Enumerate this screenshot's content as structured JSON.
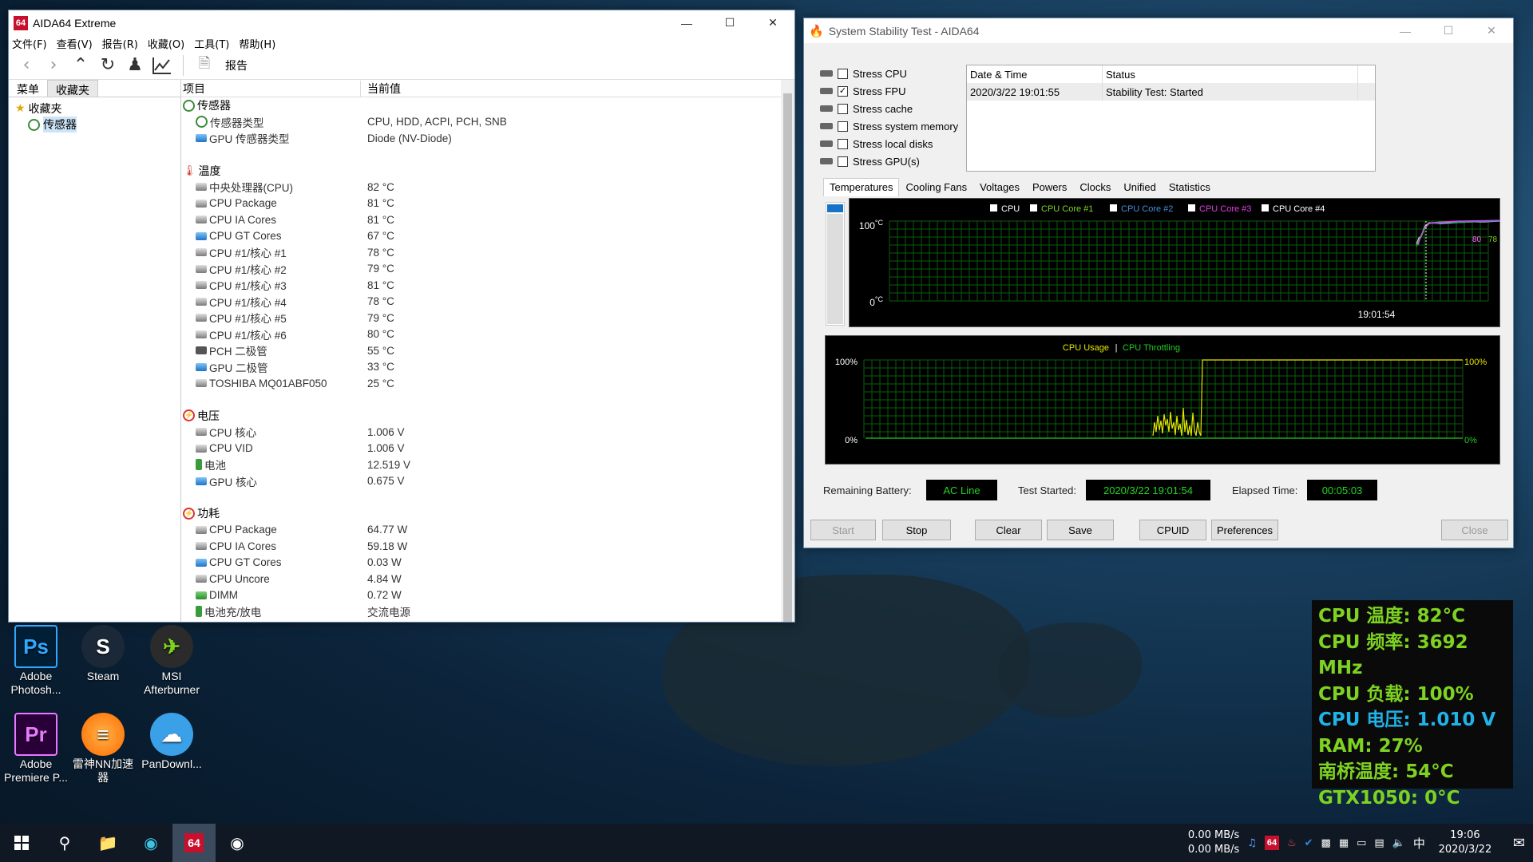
{
  "main_window": {
    "title": "AIDA64 Extreme",
    "app_icon": "64",
    "menu": [
      "文件(F)",
      "查看(V)",
      "报告(R)",
      "收藏(O)",
      "工具(T)",
      "帮助(H)"
    ],
    "report_label": "报告",
    "left_tabs": [
      "菜单",
      "收藏夹"
    ],
    "tree": {
      "root": "收藏夹",
      "child": "传感器"
    },
    "col_item": "项目",
    "col_value": "当前值",
    "rows": [
      {
        "t": "grp",
        "k": "传感器",
        "icon": "sensor-icon"
      },
      {
        "t": "item",
        "k": "传感器类型",
        "v": "CPU, HDD, ACPI, PCH, SNB",
        "icon": "sensor-icon"
      },
      {
        "t": "item",
        "k": "GPU 传感器类型",
        "v": "Diode  (NV-Diode)",
        "icon": "gpu-icon"
      },
      {
        "t": "sp"
      },
      {
        "t": "grp",
        "k": "温度",
        "icon": "thermometer-icon"
      },
      {
        "t": "item",
        "k": "中央处理器(CPU)",
        "v": "82 °C",
        "icon": "cpu-icon"
      },
      {
        "t": "item",
        "k": "CPU Package",
        "v": "81 °C",
        "icon": "cpu-icon"
      },
      {
        "t": "item",
        "k": "CPU IA Cores",
        "v": "81 °C",
        "icon": "cpu-icon"
      },
      {
        "t": "item",
        "k": "CPU GT Cores",
        "v": "67 °C",
        "icon": "gpu-icon"
      },
      {
        "t": "item",
        "k": "CPU #1/核心 #1",
        "v": "78 °C",
        "icon": "cpu-icon"
      },
      {
        "t": "item",
        "k": "CPU #1/核心 #2",
        "v": "79 °C",
        "icon": "cpu-icon"
      },
      {
        "t": "item",
        "k": "CPU #1/核心 #3",
        "v": "81 °C",
        "icon": "cpu-icon"
      },
      {
        "t": "item",
        "k": "CPU #1/核心 #4",
        "v": "78 °C",
        "icon": "cpu-icon"
      },
      {
        "t": "item",
        "k": "CPU #1/核心 #5",
        "v": "79 °C",
        "icon": "cpu-icon"
      },
      {
        "t": "item",
        "k": "CPU #1/核心 #6",
        "v": "80 °C",
        "icon": "cpu-icon"
      },
      {
        "t": "item",
        "k": "PCH 二极管",
        "v": "55 °C",
        "icon": "chip-icon"
      },
      {
        "t": "item",
        "k": "GPU 二极管",
        "v": "33 °C",
        "icon": "gpu-icon"
      },
      {
        "t": "item",
        "k": "TOSHIBA MQ01ABF050",
        "v": "25 °C",
        "icon": "disk-icon"
      },
      {
        "t": "sp"
      },
      {
        "t": "grp",
        "k": "电压",
        "icon": "voltage-icon"
      },
      {
        "t": "item",
        "k": "CPU 核心",
        "v": "1.006 V",
        "icon": "cpu-icon"
      },
      {
        "t": "item",
        "k": "CPU VID",
        "v": "1.006 V",
        "icon": "cpu-icon"
      },
      {
        "t": "item",
        "k": "电池",
        "v": "12.519 V",
        "icon": "battery-icon"
      },
      {
        "t": "item",
        "k": "GPU 核心",
        "v": "0.675 V",
        "icon": "gpu-icon"
      },
      {
        "t": "sp"
      },
      {
        "t": "grp",
        "k": "功耗",
        "icon": "power-icon"
      },
      {
        "t": "item",
        "k": "CPU Package",
        "v": "64.77 W",
        "icon": "cpu-icon"
      },
      {
        "t": "item",
        "k": "CPU IA Cores",
        "v": "59.18 W",
        "icon": "cpu-icon"
      },
      {
        "t": "item",
        "k": "CPU GT Cores",
        "v": "0.03 W",
        "icon": "gpu-icon"
      },
      {
        "t": "item",
        "k": "CPU Uncore",
        "v": "4.84 W",
        "icon": "cpu-icon"
      },
      {
        "t": "item",
        "k": "DIMM",
        "v": "0.72 W",
        "icon": "ram-icon"
      },
      {
        "t": "item",
        "k": "电池充/放电",
        "v": "交流电源",
        "icon": "battery-icon"
      }
    ]
  },
  "stability": {
    "title": "System Stability Test - AIDA64",
    "stress": [
      {
        "label": "Stress CPU",
        "checked": false
      },
      {
        "label": "Stress FPU",
        "checked": true
      },
      {
        "label": "Stress cache",
        "checked": false
      },
      {
        "label": "Stress system memory",
        "checked": false
      },
      {
        "label": "Stress local disks",
        "checked": false
      },
      {
        "label": "Stress GPU(s)",
        "checked": false
      }
    ],
    "status_headers": {
      "date": "Date & Time",
      "status": "Status"
    },
    "status_row": {
      "date": "2020/3/22 19:01:55",
      "status": "Stability Test: Started"
    },
    "tabs": [
      "Temperatures",
      "Cooling Fans",
      "Voltages",
      "Powers",
      "Clocks",
      "Unified",
      "Statistics"
    ],
    "temp_legend": [
      "CPU",
      "CPU Core #1",
      "CPU Core #2",
      "CPU Core #3",
      "CPU Core #4"
    ],
    "temp_y_top": "100",
    "temp_y_bottom": "0",
    "temp_unit": "°C",
    "temp_time": "19:01:54",
    "temp_end_a": "80",
    "temp_end_b": "78",
    "usage_title_a": "CPU Usage",
    "usage_sep": "|",
    "usage_title_b": "CPU Throttling",
    "usage_top": "100%",
    "usage_bottom": "0%",
    "battery_label": "Remaining Battery:",
    "battery_value": "AC Line",
    "started_label": "Test Started:",
    "started_value": "2020/3/22 19:01:54",
    "elapsed_label": "Elapsed Time:",
    "elapsed_value": "00:05:03",
    "buttons": {
      "start": "Start",
      "stop": "Stop",
      "clear": "Clear",
      "save": "Save",
      "cpuid": "CPUID",
      "prefs": "Preferences",
      "close": "Close"
    }
  },
  "desktop_icons": [
    {
      "label": "Adobe Photosh...",
      "glyph": "Ps"
    },
    {
      "label": "Steam",
      "glyph": "S"
    },
    {
      "label": "MSI Afterburner",
      "glyph": "✈"
    },
    {
      "label": "Adobe Premiere P...",
      "glyph": "Pr"
    },
    {
      "label": "雷神NN加速器",
      "glyph": "≡"
    },
    {
      "label": "PanDownl...",
      "glyph": "☁"
    }
  ],
  "osd": [
    {
      "text": "CPU 温度: 82°C",
      "color": "#7ed321"
    },
    {
      "text": "CPU 频率: 3692 MHz",
      "color": "#7ed321"
    },
    {
      "text": "CPU 负载: 100%",
      "color": "#7ed321"
    },
    {
      "text": "CPU 电压: 1.010 V",
      "color": "#1fb3e8"
    },
    {
      "text": "RAM: 27%",
      "color": "#7ed321"
    },
    {
      "text": "南桥温度: 54°C",
      "color": "#7ed321"
    },
    {
      "text": "GTX1050: 0°C",
      "color": "#7ed321"
    }
  ],
  "taskbar": {
    "net_up": "0.00 MB/s",
    "net_down": "0.00 MB/s",
    "ime": "中",
    "time": "19:06",
    "date": "2020/3/22"
  }
}
